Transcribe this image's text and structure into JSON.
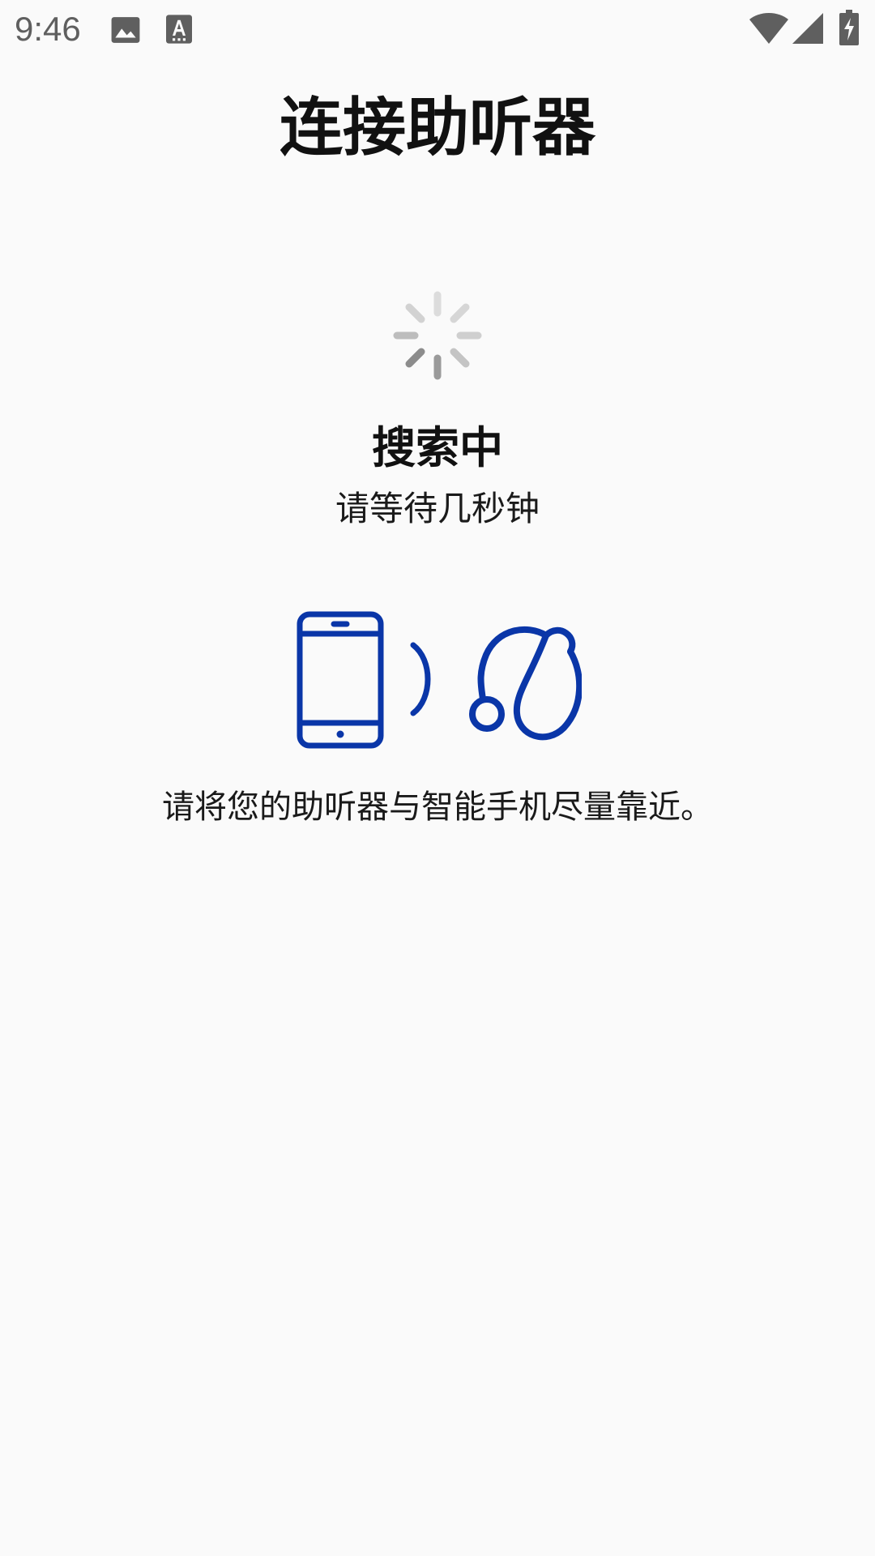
{
  "status_bar": {
    "time": "9:46",
    "icons": [
      "image-icon",
      "font-download-icon",
      "wifi-icon",
      "cell-signal-icon",
      "battery-charging-icon"
    ]
  },
  "page": {
    "title": "连接助听器",
    "status": "搜索中",
    "subtitle": "请等待几秒钟",
    "instruction": "请将您的助听器与智能手机尽量靠近。"
  },
  "icons": {
    "spinner": "loading-spinner-icon",
    "illustration": [
      "smartphone-icon",
      "wireless-signal-icon",
      "hearing-aid-icon"
    ]
  },
  "colors": {
    "background": "#fafafa",
    "text": "#111111",
    "status_bar_gray": "#5f5f5f",
    "illustration_blue": "#0a36a8",
    "spinner_gray": "#9e9e9e"
  }
}
